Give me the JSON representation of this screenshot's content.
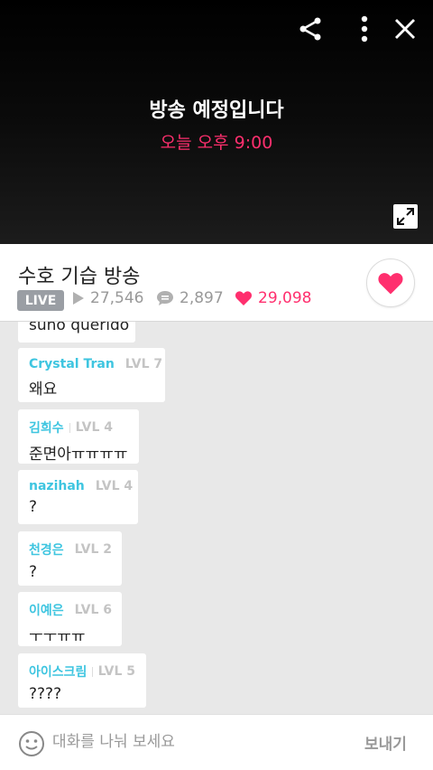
{
  "player": {
    "status_title": "방송 예정입니다",
    "status_time": "오늘 오후 9:00",
    "icons": [
      "share-icon",
      "more-vertical-icon",
      "close-icon",
      "expand-icon"
    ]
  },
  "stream": {
    "title": "수호 기습 방송",
    "badge": "LIVE",
    "views": "27,546",
    "comments": "2,897",
    "likes": "29,098"
  },
  "chat": {
    "messages": [
      {
        "user": "",
        "level": "",
        "text": "suho querido"
      },
      {
        "user": "Crystal Tran",
        "level": "LVL 7",
        "text": "왜요"
      },
      {
        "user": "김희수",
        "level": "LVL 4",
        "text": "준면아ㅠㅠㅠㅠ"
      },
      {
        "user": "nazihah",
        "level": "LVL 4",
        "text": "?"
      },
      {
        "user": "천경은",
        "level": "LVL 2",
        "text": "?"
      },
      {
        "user": "이예은",
        "level": "LVL 6",
        "text": "ㅜㅜㅠㅠ"
      },
      {
        "user": "아이스크림",
        "level": "LVL 5",
        "text": "????"
      }
    ]
  },
  "composer": {
    "placeholder": "대화를 나눠 보세요",
    "send_label": "보내기"
  },
  "colors": {
    "accent": "#ff2f6e",
    "username": "#3ec5e0",
    "badge": "#9a9ea4"
  }
}
